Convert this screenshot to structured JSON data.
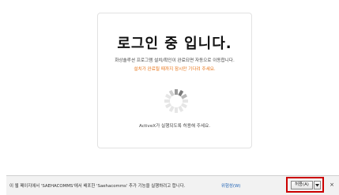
{
  "panel": {
    "title": "로그인 중 입니다.",
    "description": "화상솔루션 프로그램 설치/확인이 완료되면 자동으로 이동합니다.",
    "wait_notice": "설치가 완료될 때까지 잠시만 기다려 주세요.",
    "activex_notice": "ActiveX가 실행되도록 허용해 주세요.",
    "spinner_icon": "loading-spinner-icon"
  },
  "notification_bar": {
    "message": "이 웹 페이지에서 'SAEHACOMMS'에서 배포한 'Saehacomms' 추가 기능을 실행하려고 합니다.",
    "risk_link": "위험성(W)",
    "allow_label": "허용(A)",
    "dropdown_icon": "caret-down-icon",
    "close_label": "×",
    "highlight_color": "#cc0000"
  },
  "colors": {
    "wait_text": "#e8751a",
    "link": "#1a5fb4"
  }
}
